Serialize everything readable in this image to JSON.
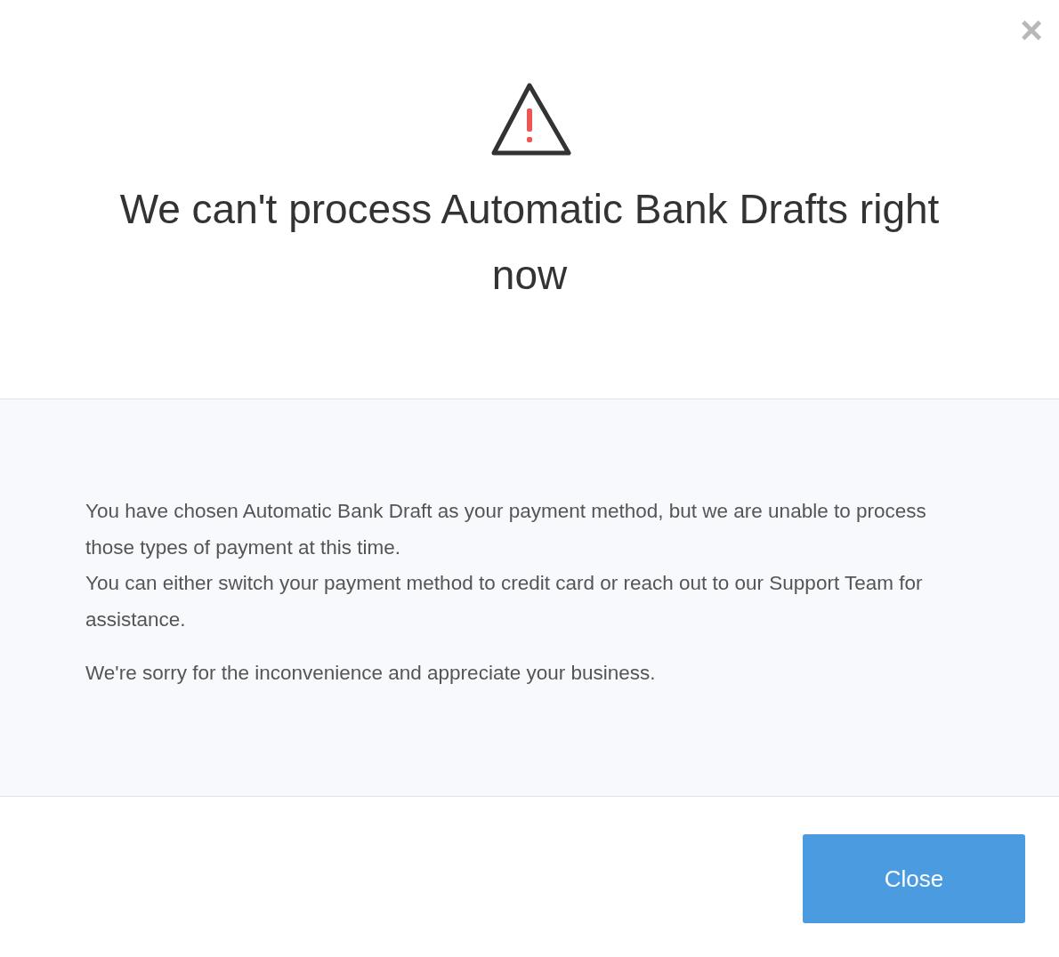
{
  "dialog": {
    "close_icon": "×",
    "title": "We can't process Automatic Bank Drafts right now",
    "message_groups": [
      [
        "You have chosen Automatic Bank Draft as your payment method, but we are unable to process those types of payment at this time.",
        "You can either switch your payment method to credit card or reach out to our Support Team for assistance."
      ],
      [
        "We're sorry for the inconvenience and appreciate your business."
      ]
    ],
    "buttons": [
      "Close"
    ]
  }
}
